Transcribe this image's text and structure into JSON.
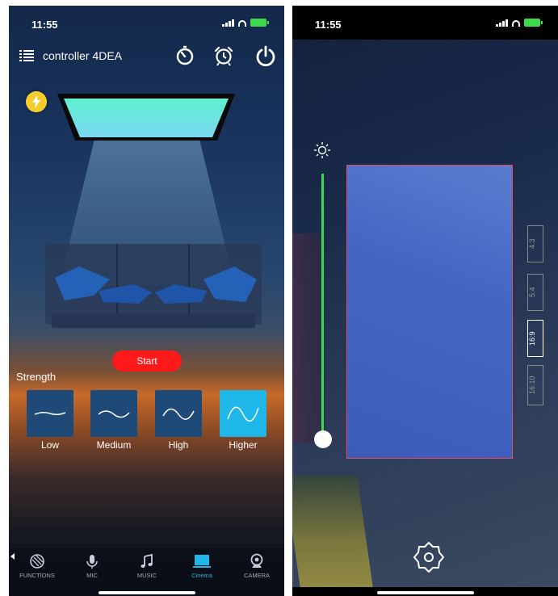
{
  "left": {
    "status": {
      "time": "11:55"
    },
    "header": {
      "title": "controller 4DEA"
    },
    "start_label": "Start",
    "strength": {
      "label": "Strength",
      "options": [
        {
          "label": "Low"
        },
        {
          "label": "Medium"
        },
        {
          "label": "High"
        },
        {
          "label": "Higher"
        }
      ],
      "selected": "Higher"
    },
    "nav": [
      {
        "label": "FUNCTIONS",
        "icon": "functions-icon"
      },
      {
        "label": "MIC",
        "icon": "mic-icon"
      },
      {
        "label": "MUSIC",
        "icon": "music-note-icon"
      },
      {
        "label": "Cinema",
        "icon": "cinema-screen-icon"
      },
      {
        "label": "CAMERA",
        "icon": "webcam-icon"
      }
    ],
    "active_nav": "Cinema",
    "colors": {
      "accent": "#1fb6e8",
      "start": "#ff1a1a",
      "tv_glow": "#5ff0d0"
    }
  },
  "right": {
    "status": {
      "time": "11:55"
    },
    "aspect_ratios": [
      {
        "label": "4:3"
      },
      {
        "label": "5:4"
      },
      {
        "label": "16:9"
      },
      {
        "label": "16:10"
      }
    ],
    "selected_ratio": "16:9",
    "brightness_level": 1.0,
    "colors": {
      "frame": "#e34b5f",
      "slider": "#3ddb4c"
    }
  }
}
